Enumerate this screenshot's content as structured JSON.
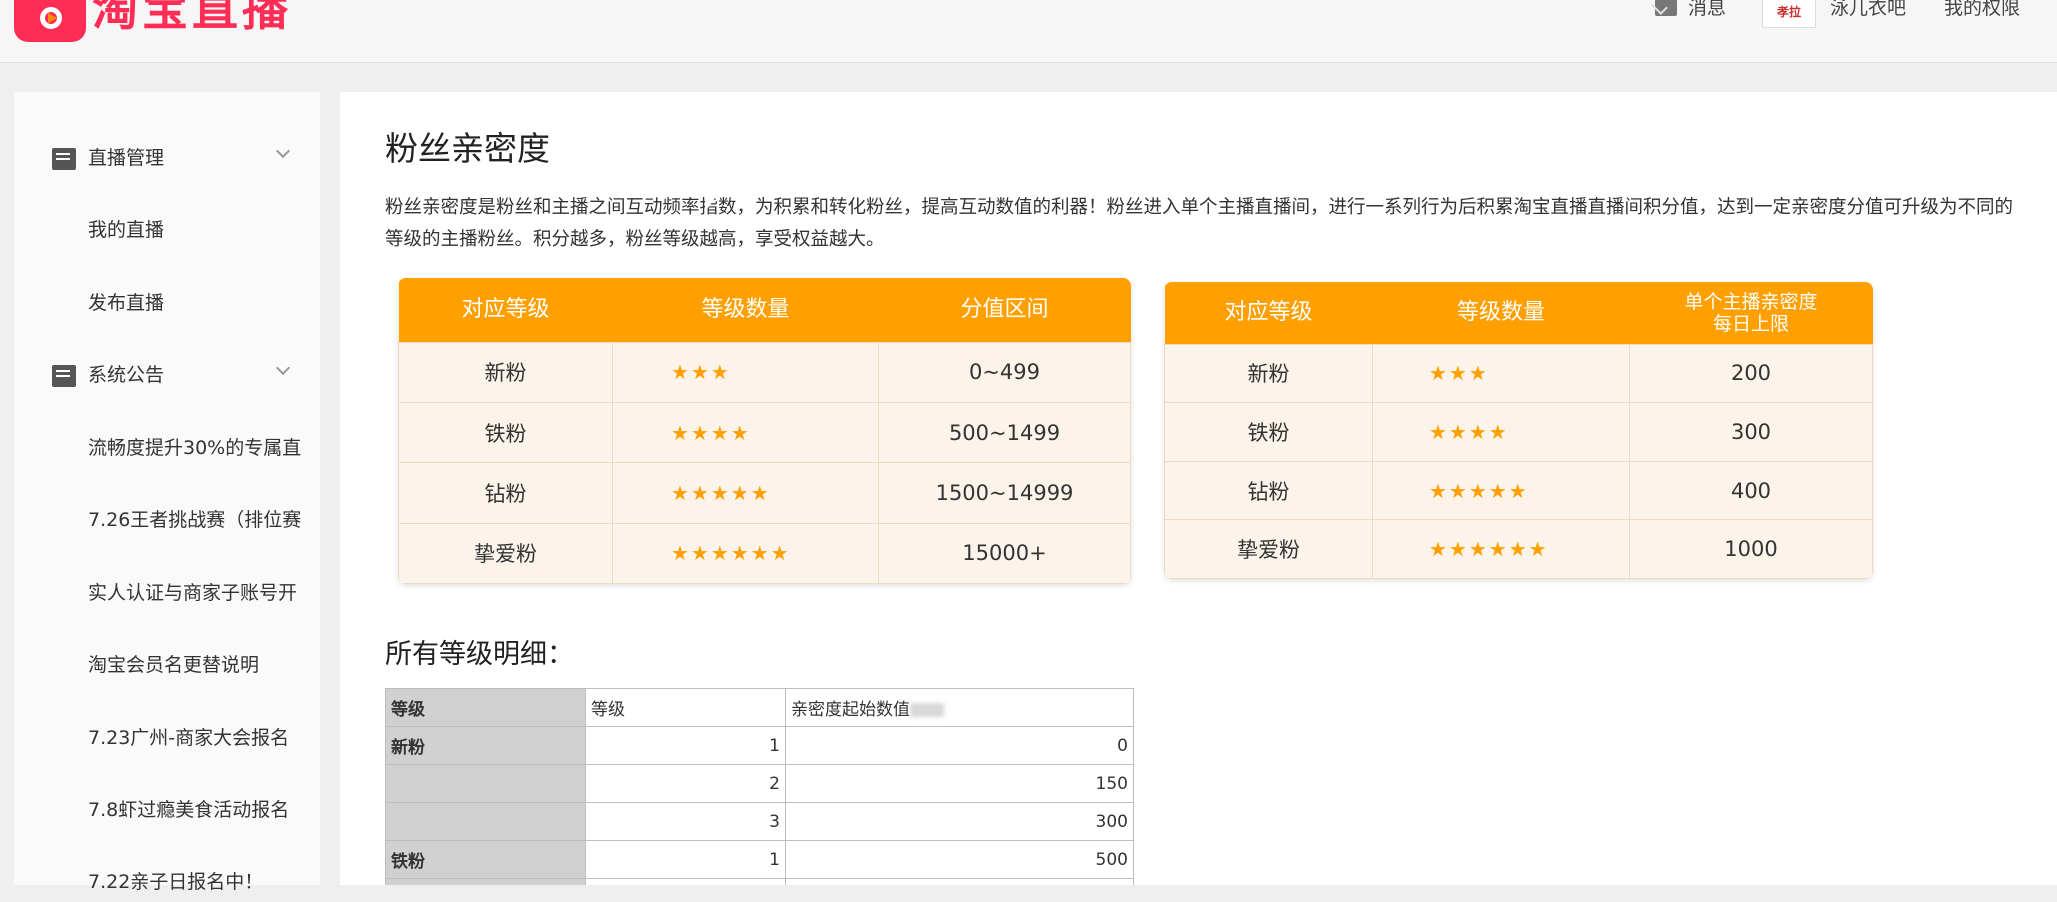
{
  "header": {
    "brand": "淘宝直播",
    "messages": "消息",
    "avatar_text": "孝拉",
    "shop_name": "泳儿衣吧",
    "permissions": "我的权限"
  },
  "sidebar": {
    "items": [
      {
        "label": "直播管理",
        "type": "group"
      },
      {
        "label": "我的直播",
        "type": "link"
      },
      {
        "label": "发布直播",
        "type": "link"
      },
      {
        "label": "系统公告",
        "type": "group"
      },
      {
        "label": "流畅度提升30%的专属直",
        "type": "link"
      },
      {
        "label": "7.26王者挑战赛（排位赛",
        "type": "link"
      },
      {
        "label": "实人认证与商家子账号开",
        "type": "link"
      },
      {
        "label": "淘宝会员名更替说明",
        "type": "link"
      },
      {
        "label": "7.23广州-商家大会报名",
        "type": "link"
      },
      {
        "label": "7.8虾过瘾美食活动报名",
        "type": "link"
      },
      {
        "label": "7.22亲子日报名中！",
        "type": "link"
      }
    ]
  },
  "main": {
    "title": "粉丝亲密度",
    "description": "粉丝亲密度是粉丝和主播之间互动频率指数，为积累和转化粉丝，提高互动数值的利器！粉丝进入单个主播直播间，进行一系列行为后积累淘宝直播直播间积分值，达到一定亲密度分值可升级为不同的等级的主播粉丝。积分越多，粉丝等级越高，享受权益越大。",
    "table1": {
      "headers": [
        "对应等级",
        "等级数量",
        "分值区间"
      ],
      "rows": [
        {
          "level": "新粉",
          "stars": "★★★",
          "value": "0~499"
        },
        {
          "level": "铁粉",
          "stars": "★★★★",
          "value": "500~1499"
        },
        {
          "level": "钻粉",
          "stars": "★★★★★",
          "value": "1500~14999"
        },
        {
          "level": "挚爱粉",
          "stars": "★★★★★★",
          "value": "15000+"
        }
      ]
    },
    "table2": {
      "headers": [
        "对应等级",
        "等级数量",
        "单个主播亲密度\n每日上限"
      ],
      "header3_line1": "单个主播亲密度",
      "header3_line2": "每日上限",
      "rows": [
        {
          "level": "新粉",
          "stars": "★★★",
          "value": "200"
        },
        {
          "level": "铁粉",
          "stars": "★★★★",
          "value": "300"
        },
        {
          "level": "钻粉",
          "stars": "★★★★★",
          "value": "400"
        },
        {
          "level": "挚爱粉",
          "stars": "★★★★★★",
          "value": "1000"
        }
      ]
    },
    "detail_title": "所有等级明细：",
    "sheet": {
      "headers": [
        "等级",
        "等级",
        "亲密度起始数值"
      ],
      "rows": [
        {
          "name": "新粉",
          "level": "1",
          "start": "0"
        },
        {
          "name": "",
          "level": "2",
          "start": "150"
        },
        {
          "name": "",
          "level": "3",
          "start": "300"
        },
        {
          "name": "铁粉",
          "level": "1",
          "start": "500"
        }
      ]
    }
  },
  "colors": {
    "brand": "#ff2c55",
    "accent": "#ff9f00",
    "card_bg": "#fcf4ea"
  }
}
